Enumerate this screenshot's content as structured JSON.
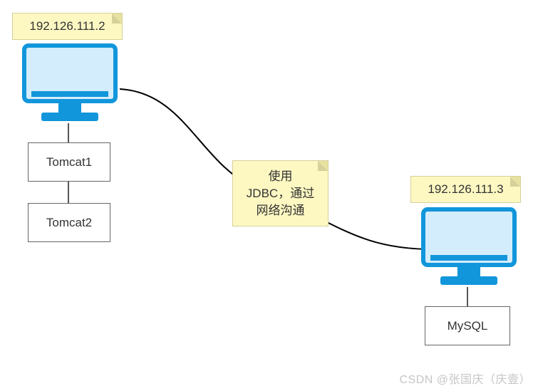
{
  "left_ip_note": "192.126.111.2",
  "right_ip_note": "192.126.111.3",
  "center_note_line1": "使用",
  "center_note_line2": "JDBC，通过",
  "center_note_line3": "网络沟通",
  "tomcat1_label": "Tomcat1",
  "tomcat2_label": "Tomcat2",
  "mysql_label": "MySQL",
  "watermark": "CSDN @张国庆（庆壹）",
  "left_monitor_icon": "monitor-icon",
  "right_monitor_icon": "monitor-icon",
  "colors": {
    "note_bg": "#fdf8c2",
    "note_border": "#d6d09a",
    "monitor_frame": "#1296db",
    "monitor_screen": "#d4edfc",
    "box_border": "#666666"
  }
}
